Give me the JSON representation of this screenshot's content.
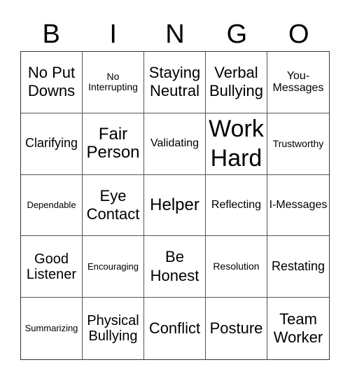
{
  "header": [
    "B",
    "I",
    "N",
    "G",
    "O"
  ],
  "cells": [
    "No Put Downs",
    "No Interrupting",
    "Staying Neutral",
    "Verbal Bullying",
    "You-Messages",
    "Clarifying",
    "Fair Person",
    "Validating",
    "Work Hard",
    "Trustworthy",
    "Dependable",
    "Eye Contact",
    "Helper",
    "Reflecting",
    "I-Messages",
    "Good Listener",
    "Encouraging",
    "Be Honest",
    "Resolution",
    "Restating",
    "Summarizing",
    "Physical Bullying",
    "Conflict",
    "Posture",
    "Team Worker"
  ]
}
